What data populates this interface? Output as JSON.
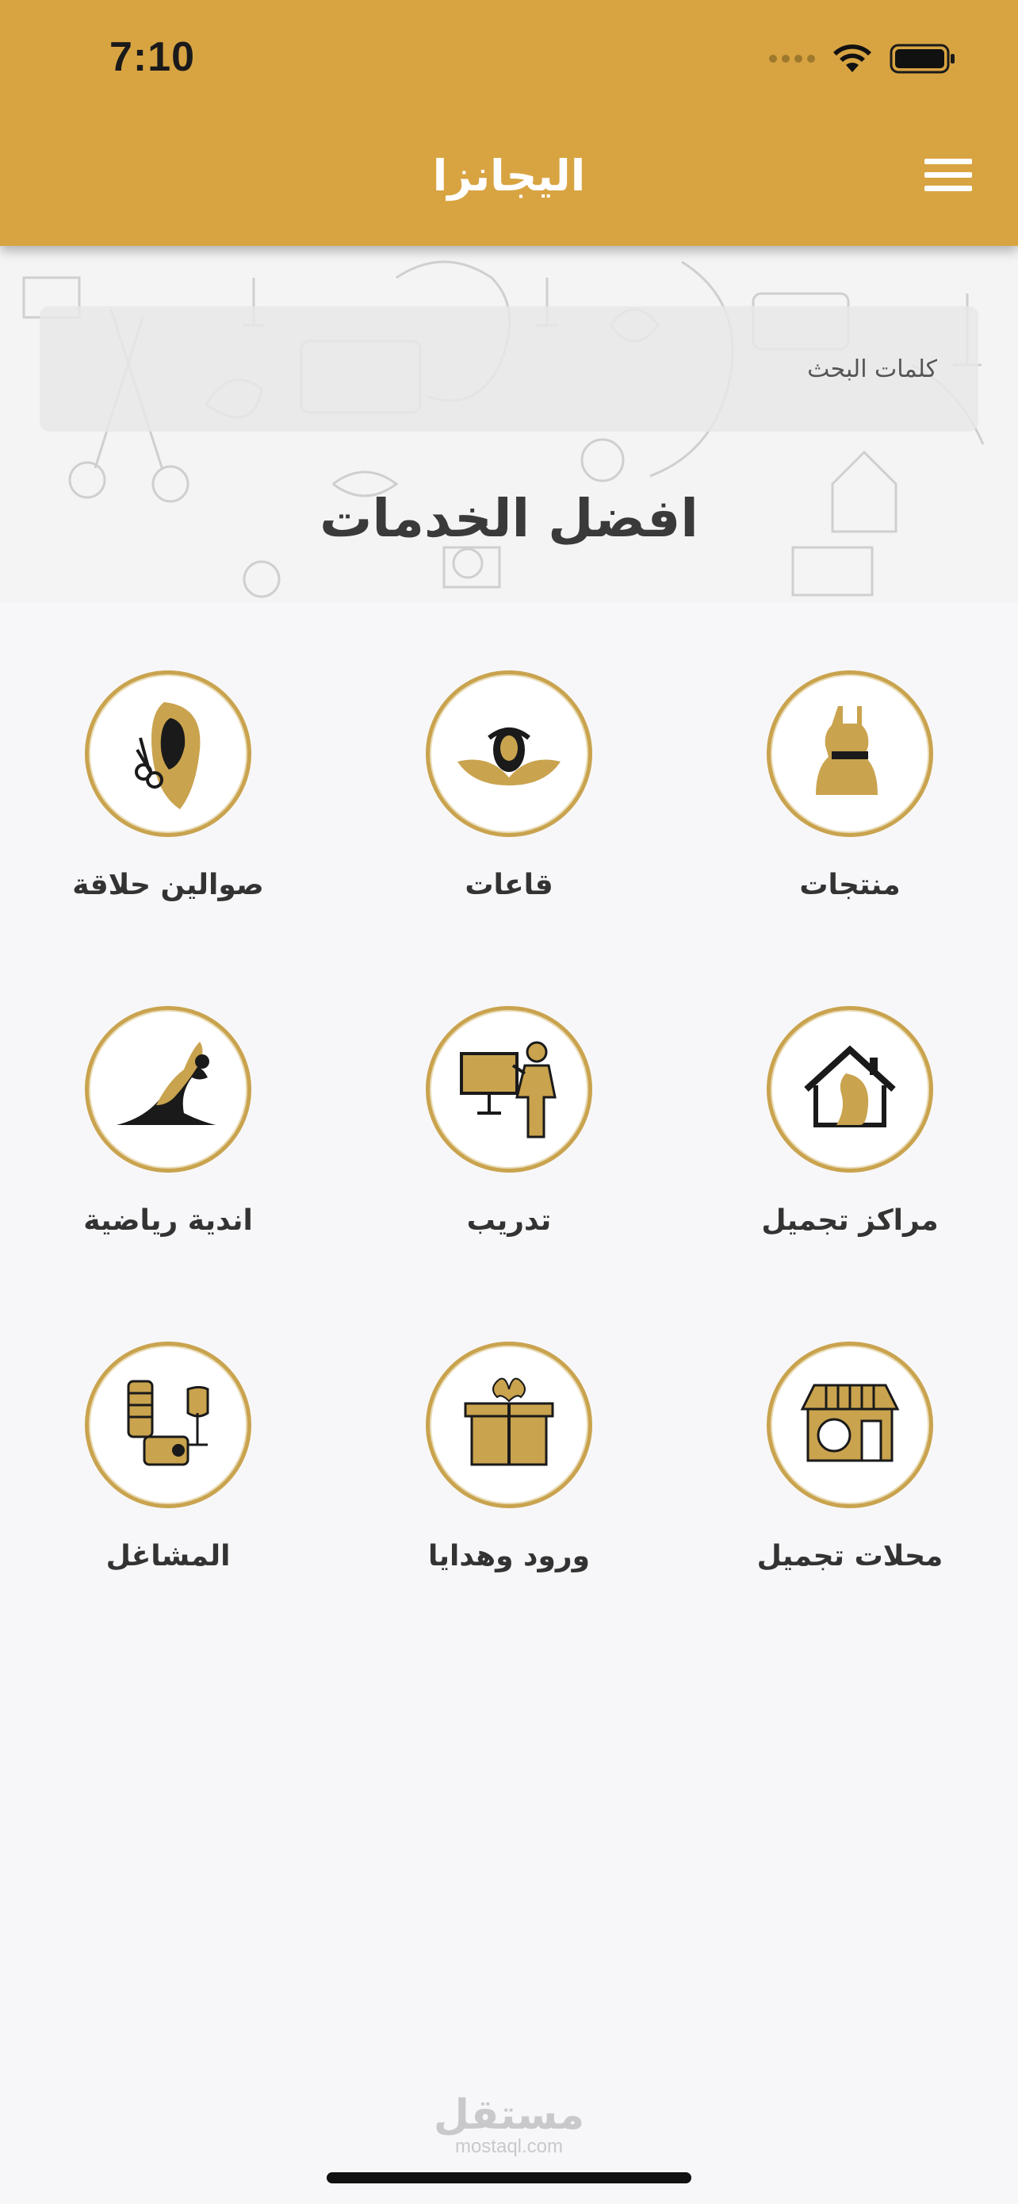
{
  "status_bar": {
    "time": "7:10"
  },
  "header": {
    "title": "اليجانزا"
  },
  "search": {
    "placeholder": "كلمات البحث"
  },
  "section_title": "افضل الخدمات",
  "categories": [
    {
      "label": "منتجات",
      "icon": "dress-icon"
    },
    {
      "label": "قاعات",
      "icon": "hall-icon"
    },
    {
      "label": "صوالين حلاقة",
      "icon": "salon-icon"
    },
    {
      "label": "مراكز تجميل",
      "icon": "beauty-center-icon"
    },
    {
      "label": "تدريب",
      "icon": "training-icon"
    },
    {
      "label": "اندية رياضية",
      "icon": "sports-club-icon"
    },
    {
      "label": "محلات تجميل",
      "icon": "beauty-shop-icon"
    },
    {
      "label": "ورود وهدايا",
      "icon": "gifts-icon"
    },
    {
      "label": "المشاغل",
      "icon": "tailoring-icon"
    }
  ],
  "watermark": {
    "arabic": "مستقل",
    "english": "mostaql.com"
  },
  "colors": {
    "header": "#d8a442",
    "gold": "#c9a34e",
    "background": "#f7f7f9"
  }
}
